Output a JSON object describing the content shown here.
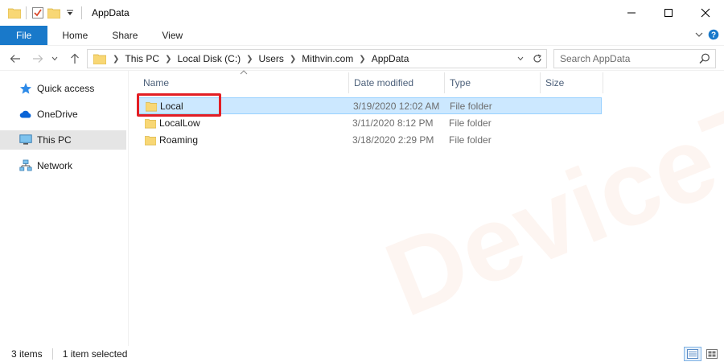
{
  "window": {
    "title": "AppData"
  },
  "ribbon": {
    "tabs": [
      {
        "label": "File"
      },
      {
        "label": "Home"
      },
      {
        "label": "Share"
      },
      {
        "label": "View"
      }
    ]
  },
  "address": {
    "breadcrumbs": [
      "This PC",
      "Local Disk (C:)",
      "Users",
      "Mithvin.com",
      "AppData"
    ]
  },
  "search": {
    "placeholder": "Search AppData"
  },
  "navpane": {
    "items": [
      {
        "label": "Quick access",
        "icon": "star-icon",
        "selected": false
      },
      {
        "label": "OneDrive",
        "icon": "cloud-icon",
        "selected": false
      },
      {
        "label": "This PC",
        "icon": "computer-icon",
        "selected": true
      },
      {
        "label": "Network",
        "icon": "network-icon",
        "selected": false
      }
    ]
  },
  "filelist": {
    "columns": [
      "Name",
      "Date modified",
      "Type",
      "Size"
    ],
    "rows": [
      {
        "name": "Local",
        "date": "3/19/2020 12:02 AM",
        "type": "File folder",
        "size": "",
        "selected": true
      },
      {
        "name": "LocalLow",
        "date": "3/11/2020 8:12 PM",
        "type": "File folder",
        "size": "",
        "selected": false
      },
      {
        "name": "Roaming",
        "date": "3/18/2020 2:29 PM",
        "type": "File folder",
        "size": "",
        "selected": false
      }
    ]
  },
  "statusbar": {
    "item_count": "3 items",
    "selection": "1 item selected"
  },
  "watermark": {
    "text": "DeviceTricks"
  },
  "colors": {
    "accent": "#1979ca",
    "selection_fill": "#cce8ff",
    "selection_border": "#99d1ff",
    "highlight": "#e31e24",
    "folder": "#f8d775"
  }
}
